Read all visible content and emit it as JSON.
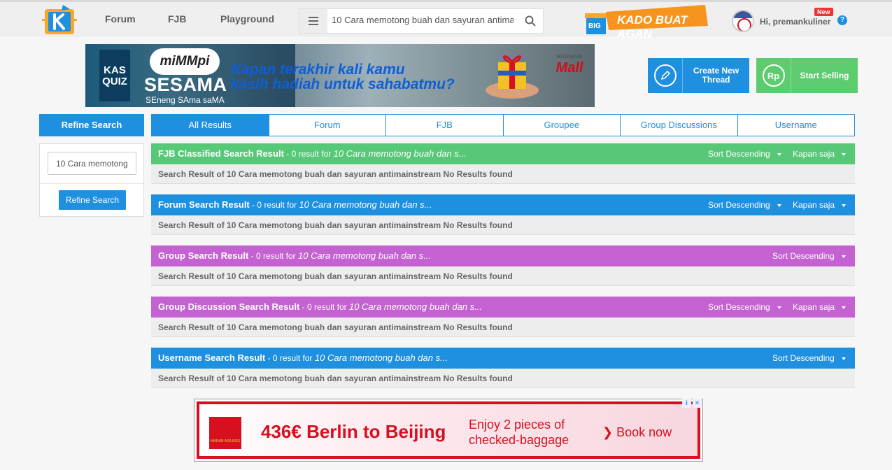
{
  "nav": {
    "items": [
      "Forum",
      "FJB",
      "Playground"
    ]
  },
  "search": {
    "value": "10 Cara memotong buah dan sayuran antimai",
    "placeholder": ""
  },
  "promo": {
    "text": "KADO BUAT AGAN",
    "tag": "BIG"
  },
  "user": {
    "greeting": "Hi, premankuliner",
    "new_badge": "New",
    "help": "?"
  },
  "banner": {
    "kas_quiz": "KAS QUIZ",
    "cloud": "miMMpi",
    "title": "SESAMA",
    "subtitle": "SEneng SAma saMA",
    "headline_line1": "Kapan terakhir kali kamu",
    "headline_line2": "kasih hadiah untuk sahabatmu?",
    "mall_top": "MATAHARI",
    "mall_name": "Mall"
  },
  "cta": {
    "create_line1": "Create New",
    "create_line2": "Thread",
    "sell_label": "Start Selling",
    "sell_icon": "Rp"
  },
  "sidebar": {
    "header": "Refine Search",
    "input_value": "10 Cara memotong",
    "button": "Refine Search"
  },
  "tabs": [
    "All Results",
    "Forum",
    "FJB",
    "Groupee",
    "Group Discussions",
    "Username"
  ],
  "results": [
    {
      "title": "FJB Classified Search Result",
      "meta": " - 0 result for ",
      "query": "10 Cara memotong buah dan s...",
      "sort": "Sort Descending",
      "time": "Kapan saja",
      "body": "Search Result of 10 Cara memotong buah dan sayuran antimainstream No Results found"
    },
    {
      "title": "Forum Search Result",
      "meta": " - 0 result for ",
      "query": "10 Cara memotong buah dan s...",
      "sort": "Sort Descending",
      "time": "Kapan saja",
      "body": "Search Result of 10 Cara memotong buah dan sayuran antimainstream No Results found"
    },
    {
      "title": "Group Search Result",
      "meta": " - 0 result for ",
      "query": "10 Cara memotong buah dan s...",
      "sort": "Sort Descending",
      "body": "Search Result of 10 Cara memotong buah dan sayuran antimainstream No Results found"
    },
    {
      "title": "Group Discussion Search Result",
      "meta": " - 0 result for ",
      "query": "10 Cara memotong buah dan s...",
      "sort": "Sort Descending",
      "time": "Kapan saja",
      "body": "Search Result of 10 Cara memotong buah dan sayuran antimainstream No Results found"
    },
    {
      "title": "Username Search Result",
      "meta": " - 0 result for ",
      "query": "10 Cara memotong buah dan s...",
      "sort": "Sort Descending",
      "body": "Search Result of 10 Cara memotong buah dan sayuran antimainstream No Results found"
    }
  ],
  "ad": {
    "airline": "HAINAN AIRLINES",
    "price_text": "436€ Berlin to Beijing",
    "offer_line1": "Enjoy 2 pieces of",
    "offer_line2": "checked-baggage",
    "cta": "Book now"
  },
  "colors": {
    "primary": "#1f8fe0",
    "green": "#57c878",
    "purple": "#c462d1",
    "sell_green": "#5ccc6e",
    "ad_red": "#d7101f"
  }
}
